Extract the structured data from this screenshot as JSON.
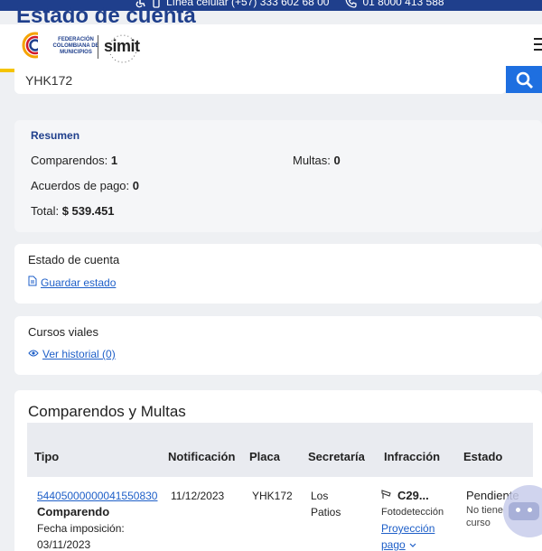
{
  "topbar": {
    "phone_mobile": "Línea celular (+57) 333 602 68 00",
    "phone_line": "01 8000 413 588"
  },
  "page_title": "Estado de cuenta",
  "header": {
    "org_name": "FEDERACIÓN COLOMBIANA DE MUNICIPIOS",
    "brand": "simit",
    "stripe_colors": [
      "#f5c400",
      "#1f3f8c",
      "#d11a2a"
    ]
  },
  "search": {
    "value": "YHK172"
  },
  "resumen": {
    "title": "Resumen",
    "comparendos_label": "Comparendos:",
    "comparendos_value": "1",
    "multas_label": "Multas:",
    "multas_value": "0",
    "acuerdos_label": "Acuerdos de pago:",
    "acuerdos_value": "0",
    "total_label": "Total:",
    "total_value": "$ 539.451"
  },
  "estado_cuenta": {
    "title": "Estado de cuenta",
    "link": "Guardar estado"
  },
  "cursos": {
    "title": "Cursos viales",
    "link": "Ver historial (0)"
  },
  "comparendos": {
    "title": "Comparendos y Multas",
    "columns": [
      "Tipo",
      "Notificación",
      "Placa",
      "Secretaría",
      "Infracción",
      "Estado"
    ],
    "rows": [
      {
        "numero": "54405000000041550830",
        "tipo": "Comparendo",
        "fecha_label": "Fecha imposición:",
        "fecha": "03/11/2023",
        "notificacion": "11/12/2023",
        "placa": "YHK172",
        "secretaria_1": "Los",
        "secretaria_2": "Patios",
        "infraccion_code": "C29...",
        "infraccion_tipo": "Fotodetección",
        "proyeccion_1": "Proyección",
        "proyeccion_2": "pago",
        "estado": "Pendiente",
        "curso_1": "No tiene",
        "curso_2": "curso"
      }
    ]
  }
}
